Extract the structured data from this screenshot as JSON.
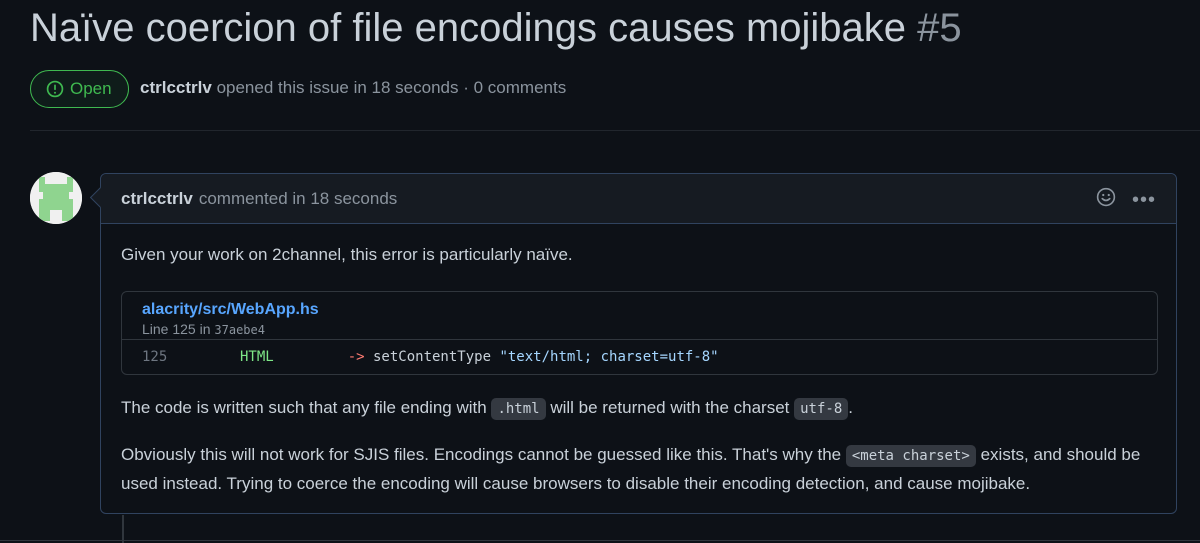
{
  "issue": {
    "title": "Naïve coercion of file encodings causes mojibake",
    "number": "#5",
    "state": "Open",
    "author": "ctrlcctrlv",
    "meta_text": "opened this issue in 18 seconds · 0 comments"
  },
  "comment": {
    "author": "ctrlcctrlv",
    "meta_text": "commented in 18 seconds",
    "p1": "Given your work on 2channel, this error is particularly naïve.",
    "snippet": {
      "path": "alacrity/src/WebApp.hs",
      "line_label": "Line 125 in",
      "commit": "37aebe4",
      "line_number": "125",
      "code_type": "HTML",
      "code_op": "->",
      "code_fn": " setContentType ",
      "code_str": "\"text/html; charset=utf-8\""
    },
    "p2_a": "The code is written such that any file ending with",
    "p2_code1": ".html",
    "p2_b": "will be returned with the charset",
    "p2_code2": "utf-8",
    "p2_c": ".",
    "p3_a": "Obviously this will not work for SJIS files. Encodings cannot be guessed like this. That's why the",
    "p3_code": "<meta charset>",
    "p3_b": "exists, and should be used instead. Trying to coerce the encoding will cause browsers to disable their encoding detection, and cause mojibake."
  },
  "icons": {
    "state": "issue-opened-icon",
    "emoji": "smiley-icon",
    "menu": "kebab-horizontal-icon"
  },
  "colors": {
    "open": "#3fb950",
    "link": "#58a6ff",
    "background": "#0d1117",
    "avatar": "#8fd48f"
  }
}
